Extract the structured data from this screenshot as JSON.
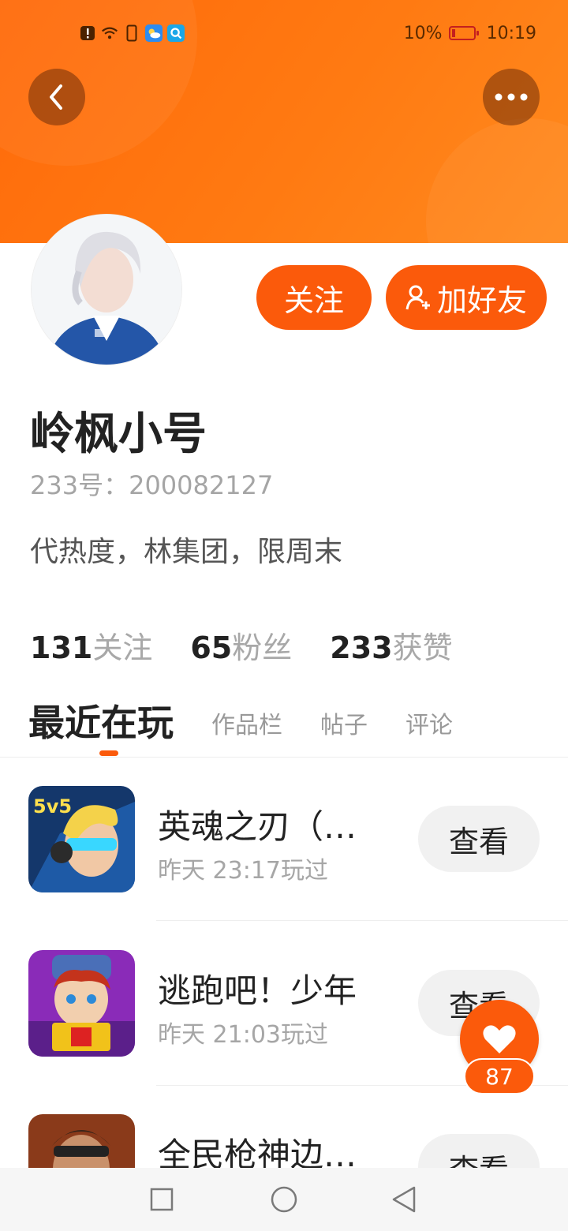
{
  "status_bar": {
    "battery_text": "10%",
    "time": "10:19",
    "icons": [
      "alert-icon",
      "wifi-icon",
      "phone-icon",
      "weather-app-icon",
      "search-app-icon"
    ]
  },
  "header": {
    "back_icon": "chevron-left-icon",
    "more_icon": "more-dots-icon"
  },
  "profile": {
    "name": "岭枫小号",
    "id_text": "233号：200082127",
    "bio": "代热度，林集团，限周末",
    "follow_label": "关注",
    "add_friend_label": "加好友"
  },
  "stats": [
    {
      "num": "131",
      "label": "关注"
    },
    {
      "num": "65",
      "label": "粉丝"
    },
    {
      "num": "233",
      "label": "获赞"
    }
  ],
  "tabs": [
    "最近在玩",
    "作品栏",
    "帖子",
    "评论"
  ],
  "games": [
    {
      "name": "英魂之刃（…",
      "time": "昨天 23:17玩过",
      "action": "查看"
    },
    {
      "name": "逃跑吧！少年",
      "time": "昨天 21:03玩过",
      "action": "查看"
    },
    {
      "name": "全民枪神边…",
      "time": "",
      "action": "查看"
    }
  ],
  "like": {
    "count": "87"
  },
  "colors": {
    "accent": "#fb5a0b",
    "header": "#ff7a12"
  }
}
